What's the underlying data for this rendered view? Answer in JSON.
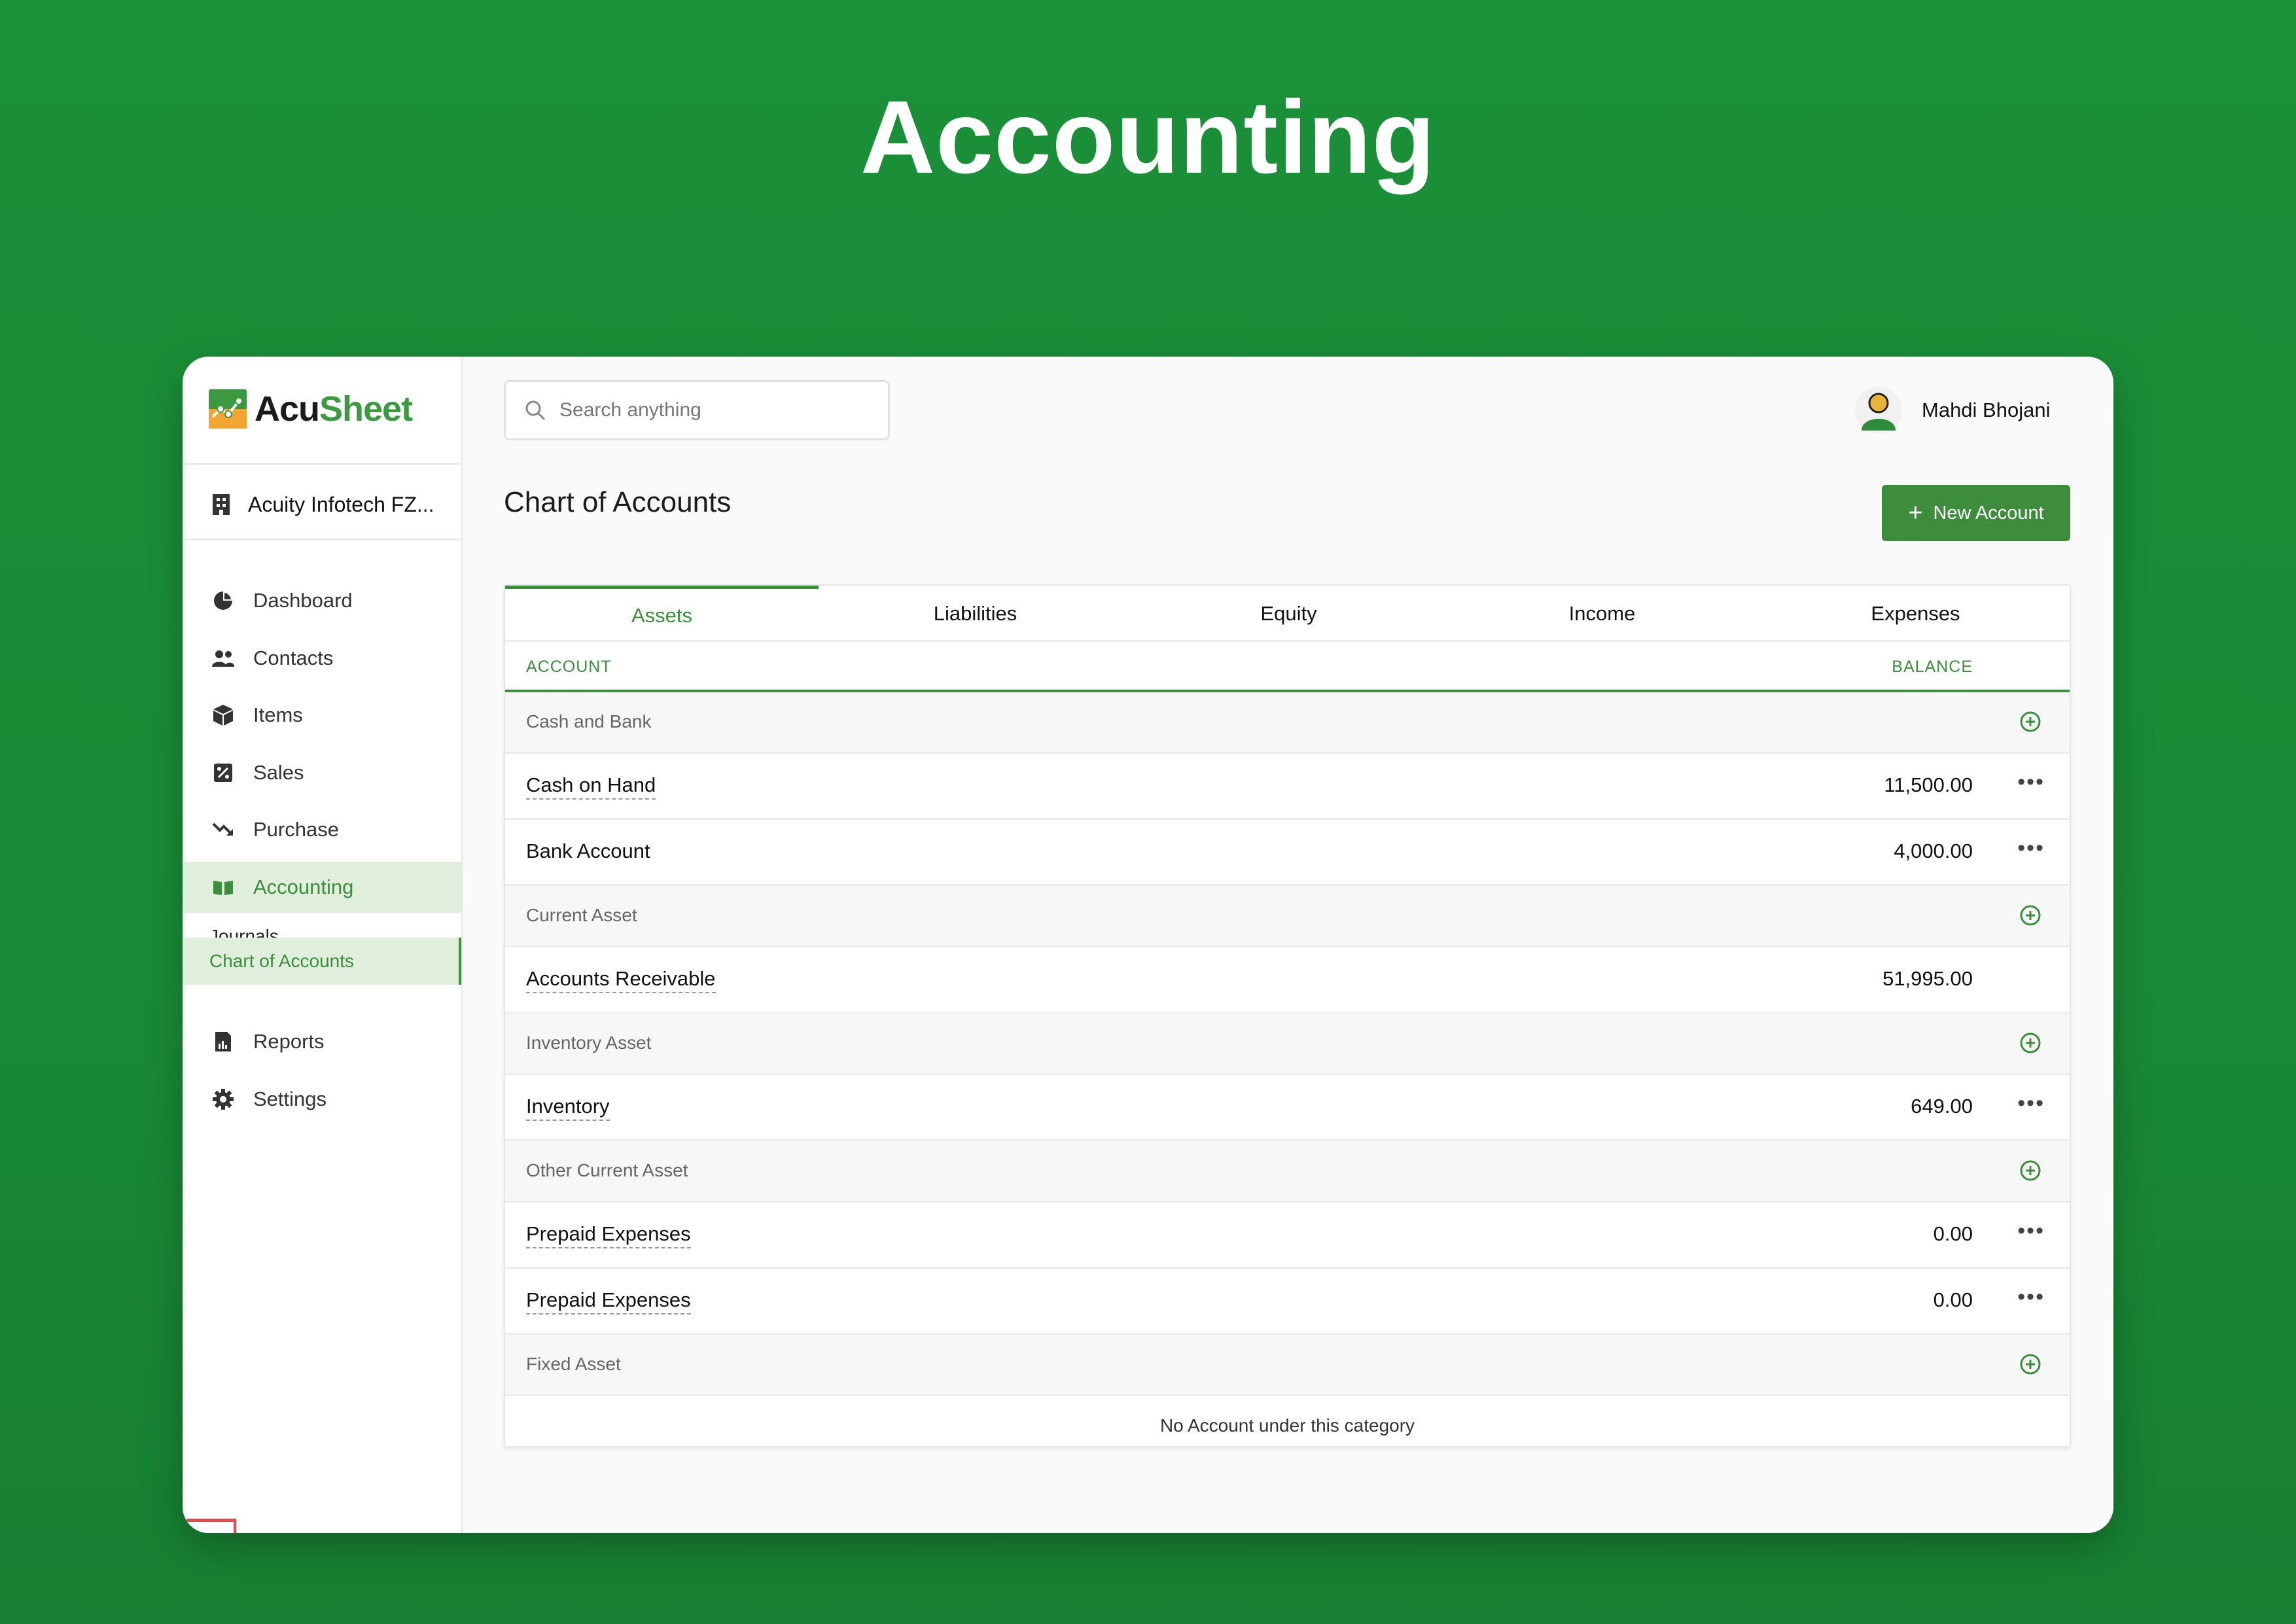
{
  "hero": {
    "title": "Accounting"
  },
  "app": {
    "logo_prefix": "Acu",
    "logo_suffix": "Sheet",
    "organization": "Acuity Infotech FZ...",
    "brand_color": "#3b8e3a"
  },
  "sidebar": {
    "items": [
      {
        "label": "Dashboard",
        "icon": "pie-chart-icon"
      },
      {
        "label": "Contacts",
        "icon": "people-icon"
      },
      {
        "label": "Items",
        "icon": "box-icon"
      },
      {
        "label": "Sales",
        "icon": "percent-tag-icon"
      },
      {
        "label": "Purchase",
        "icon": "trend-down-icon"
      },
      {
        "label": "Accounting",
        "icon": "book-icon",
        "active": true
      },
      {
        "label": "Reports",
        "icon": "report-icon"
      },
      {
        "label": "Settings",
        "icon": "gear-icon"
      }
    ],
    "subitems": [
      {
        "label": "Journals"
      },
      {
        "label": "Chart of Accounts",
        "active": true
      }
    ]
  },
  "header": {
    "search_placeholder": "Search anything",
    "user_name": "Mahdi Bhojani"
  },
  "page": {
    "title": "Chart of Accounts",
    "new_button": "New Account"
  },
  "tabs": [
    "Assets",
    "Liabilities",
    "Equity",
    "Income",
    "Expenses"
  ],
  "table": {
    "col_account": "ACCOUNT",
    "col_balance": "BALANCE",
    "groups": [
      {
        "name": "Cash and Bank",
        "accounts": [
          {
            "name": "Cash on Hand",
            "balance": "11,500.00",
            "menu": true
          },
          {
            "name": "Bank Account",
            "balance": "4,000.00",
            "menu": true
          }
        ]
      },
      {
        "name": "Current Asset",
        "accounts": [
          {
            "name": "Accounts Receivable",
            "balance": "51,995.00",
            "menu": false
          }
        ]
      },
      {
        "name": "Inventory Asset",
        "accounts": [
          {
            "name": "Inventory",
            "balance": "649.00",
            "menu": true
          }
        ]
      },
      {
        "name": "Other Current Asset",
        "accounts": [
          {
            "name": "Prepaid Expenses",
            "balance": "0.00",
            "menu": true
          },
          {
            "name": "Prepaid Expenses",
            "balance": "0.00",
            "menu": true
          }
        ]
      },
      {
        "name": "Fixed Asset",
        "accounts": []
      }
    ],
    "empty_text": "No Account under this category"
  }
}
